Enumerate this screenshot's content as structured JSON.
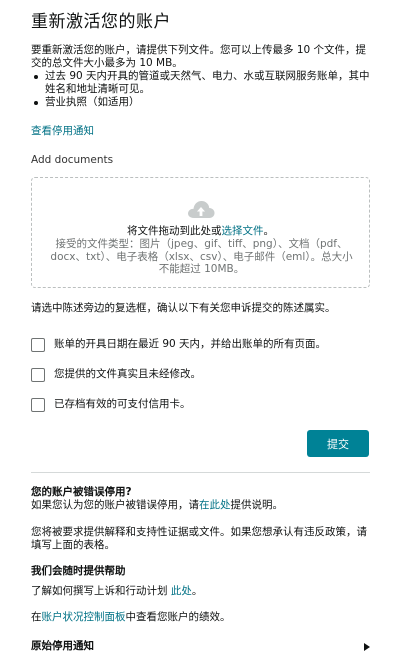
{
  "page": {
    "title": "重新激活您的账户",
    "intro": "要重新激活您的账户，请提供下列文件。您可以上传最多 10 个文件，提交的总文件大小最多为 10 MB。",
    "bullets": [
      "过去 90 天内开具的管道或天然气、电力、水或互联网服务账单，其中姓名和地址清晰可见。",
      "营业执照（如适用）"
    ],
    "view_notice_link": "查看停用通知"
  },
  "upload": {
    "section_label": "Add documents",
    "drag_text_prefix": "将文件拖动到此处或",
    "drag_text_link": "选择文件",
    "drag_text_suffix": "。",
    "accepted_types": "接受的文件类型：图片（jpeg、gif、tiff、png）、文档（pdf、docx、txt）、电子表格（xlsx、csv）、电子邮件（eml）。总大小不能超过 10MB。",
    "icon": "cloud-upload-icon"
  },
  "confirm": {
    "instruction": "请选中陈述旁边的复选框，确认以下有关您申诉提交的陈述属实。",
    "checkboxes": [
      "账单的开具日期在最近 90 天内，并给出账单的所有页面。",
      "您提供的文件真实且未经修改。",
      "已存档有效的可支付信用卡。"
    ],
    "submit_label": "提交"
  },
  "help": {
    "wrong_heading": "您的账户被错误停用?",
    "wrong_text_prefix": "如果您认为您的账户被错误停用，请",
    "wrong_text_link": "在此处",
    "wrong_text_suffix": "提供说明。",
    "appeal_text": "您将被要求提供解释和支持性证据或文件。如果您想承认有违反政策，请填写上面的表格。",
    "help_heading": "我们会随时提供帮助",
    "plan_text_prefix": "了解如何撰写上诉和行动计划 ",
    "plan_text_link": "此处",
    "plan_text_suffix": "。",
    "dashboard_prefix": "在",
    "dashboard_link": "账户状况控制面板",
    "dashboard_suffix": "中查看您账户的绩效。",
    "original_notice": "原始停用通知"
  },
  "colors": {
    "link": "#007185",
    "button": "#008296",
    "text": "#0f1111"
  }
}
